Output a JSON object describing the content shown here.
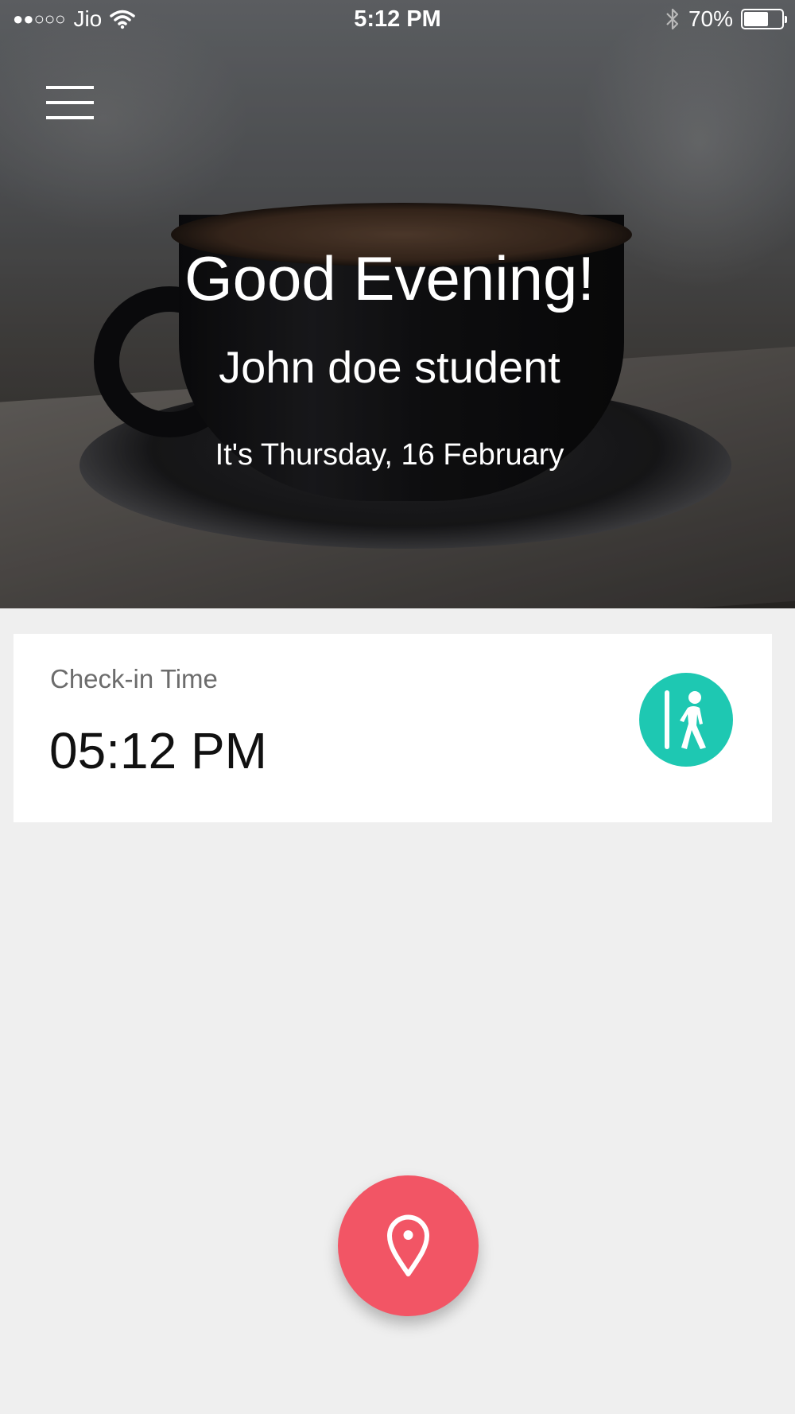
{
  "status_bar": {
    "carrier": "Jio",
    "time": "5:12 PM",
    "battery_percent": "70%",
    "battery_level": 0.7
  },
  "header": {
    "greeting": "Good Evening!",
    "user_name": "John doe student",
    "date_text": "It's Thursday, 16 February",
    "menu_icon": "hamburger-menu-icon"
  },
  "checkin": {
    "label": "Check-in Time",
    "time": "05:12 PM",
    "icon": "person-walking-door-icon"
  },
  "fab": {
    "icon": "location-pin-icon"
  },
  "colors": {
    "accent_teal": "#1ec8b2",
    "fab_red": "#f25565",
    "background": "#efefef"
  }
}
